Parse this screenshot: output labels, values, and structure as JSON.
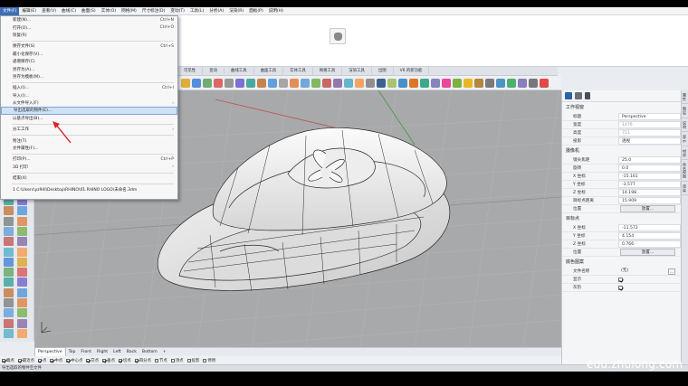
{
  "menubar": [
    "文件(F)",
    "编辑(E)",
    "查看(V)",
    "曲线(C)",
    "曲面(S)",
    "实体(O)",
    "网格(M)",
    "尺寸标注(D)",
    "变动(T)",
    "工具(L)",
    "分析(A)",
    "渲染(R)",
    "面板(P)",
    "说明(H)"
  ],
  "file_menu": [
    {
      "label": "新建(N)...",
      "shortcut": "Ctrl+N"
    },
    {
      "label": "打开(O)...",
      "shortcut": "Ctrl+O"
    },
    {
      "label": "恢复(R)",
      "shortcut": ""
    },
    {
      "sep": true
    },
    {
      "label": "保存文件(S)",
      "shortcut": "Ctrl+S"
    },
    {
      "label": "最小化保存(V)...",
      "shortcut": ""
    },
    {
      "label": "递增保存(C)",
      "shortcut": ""
    },
    {
      "label": "另存为(A)...",
      "shortcut": ""
    },
    {
      "label": "另存为模板(M)...",
      "shortcut": ""
    },
    {
      "sep": true
    },
    {
      "label": "插入(I)...",
      "shortcut": "Ctrl+I"
    },
    {
      "label": "导入(I)...",
      "shortcut": ""
    },
    {
      "label": "从文件导入(F)",
      "shortcut": "",
      "arrow": true
    },
    {
      "label": "导出选取的物件(E)...",
      "shortcut": "",
      "highlight": true
    },
    {
      "label": "以基点导出(B)...",
      "shortcut": ""
    },
    {
      "sep": true
    },
    {
      "label": "分工工作",
      "shortcut": "",
      "arrow": true
    },
    {
      "sep": true
    },
    {
      "label": "附注(T)",
      "shortcut": ""
    },
    {
      "label": "文件属性(F)...",
      "shortcut": ""
    },
    {
      "sep": true
    },
    {
      "label": "打印(P)...",
      "shortcut": "Ctrl+P"
    },
    {
      "label": "3D 打印",
      "shortcut": "",
      "arrow": true
    },
    {
      "sep": true
    },
    {
      "label": "结束(X)",
      "shortcut": ""
    },
    {
      "sep": true
    },
    {
      "label": "1 C:\\Users\\yz94l\\Desktop\\RHINO\\01.RHINO LOGO\\未命名.3dm",
      "shortcut": ""
    }
  ],
  "toolbar_tabs": [
    "可见性",
    "变动",
    "曲线工具",
    "曲面工具",
    "实体工具",
    "网格工具",
    "渲染工具",
    "出图",
    "V6 的新功能"
  ],
  "viewport_tabs": [
    "Perspective",
    "Top",
    "Front",
    "Right",
    "Left",
    "Back",
    "Bottom",
    "+"
  ],
  "osnap": [
    {
      "label": "端点",
      "on": true
    },
    {
      "label": "最近点",
      "on": true
    },
    {
      "label": "点",
      "on": true
    },
    {
      "label": "中点",
      "on": true
    },
    {
      "label": "中心点",
      "on": true
    },
    {
      "label": "交点",
      "on": true
    },
    {
      "label": "垂点",
      "on": true
    },
    {
      "label": "切点",
      "on": true
    },
    {
      "label": "四分点",
      "on": true
    },
    {
      "label": "节点",
      "on": false
    },
    {
      "label": "顶点",
      "on": false
    },
    {
      "label": "投影",
      "on": false
    },
    {
      "label": "停用",
      "on": false
    }
  ],
  "status_text": "导出选取的物件至文件",
  "panel": {
    "viewport_section": "工作视窗",
    "viewport_rows": [
      {
        "k": "标题",
        "v": "Perspective",
        "dim": false
      },
      {
        "k": "宽度",
        "v": "1476",
        "dim": true
      },
      {
        "k": "高度",
        "v": "711",
        "dim": true
      },
      {
        "k": "投影",
        "v": "透视",
        "dim": false
      }
    ],
    "camera_section": "摄像机",
    "camera_rows": [
      {
        "k": "镜头焦距",
        "v": "25.0"
      },
      {
        "k": "旋转",
        "v": "0.0"
      },
      {
        "k": "X 坐标",
        "v": "-15.161"
      },
      {
        "k": "Y 坐标",
        "v": "-3.577"
      },
      {
        "k": "Z 坐标",
        "v": "14.198"
      },
      {
        "k": "目标点距离",
        "v": "15.909"
      }
    ],
    "position_label": "位置",
    "place_button": "放置...",
    "target_section": "目标点",
    "target_rows": [
      {
        "k": "X 坐标",
        "v": "-11.572"
      },
      {
        "k": "Y 坐标",
        "v": "4.154"
      },
      {
        "k": "Z 坐标",
        "v": "0.766"
      }
    ],
    "background_section": "底色图案",
    "file_name_label": "文件名称",
    "file_name_value": "(无)",
    "show_label": "显示",
    "gray_label": "灰阶"
  },
  "side_tabs": [
    "属性",
    "图层",
    "说明",
    "显示",
    "材质",
    "命名视图",
    "渲染"
  ],
  "watermark": "edu.zhulong.com",
  "colors": {
    "accent": "#3d6fb6",
    "highlight": "#cfe1f7",
    "viewport_bg": "#a8a9ab",
    "annotation_arrow": "#e02020"
  }
}
